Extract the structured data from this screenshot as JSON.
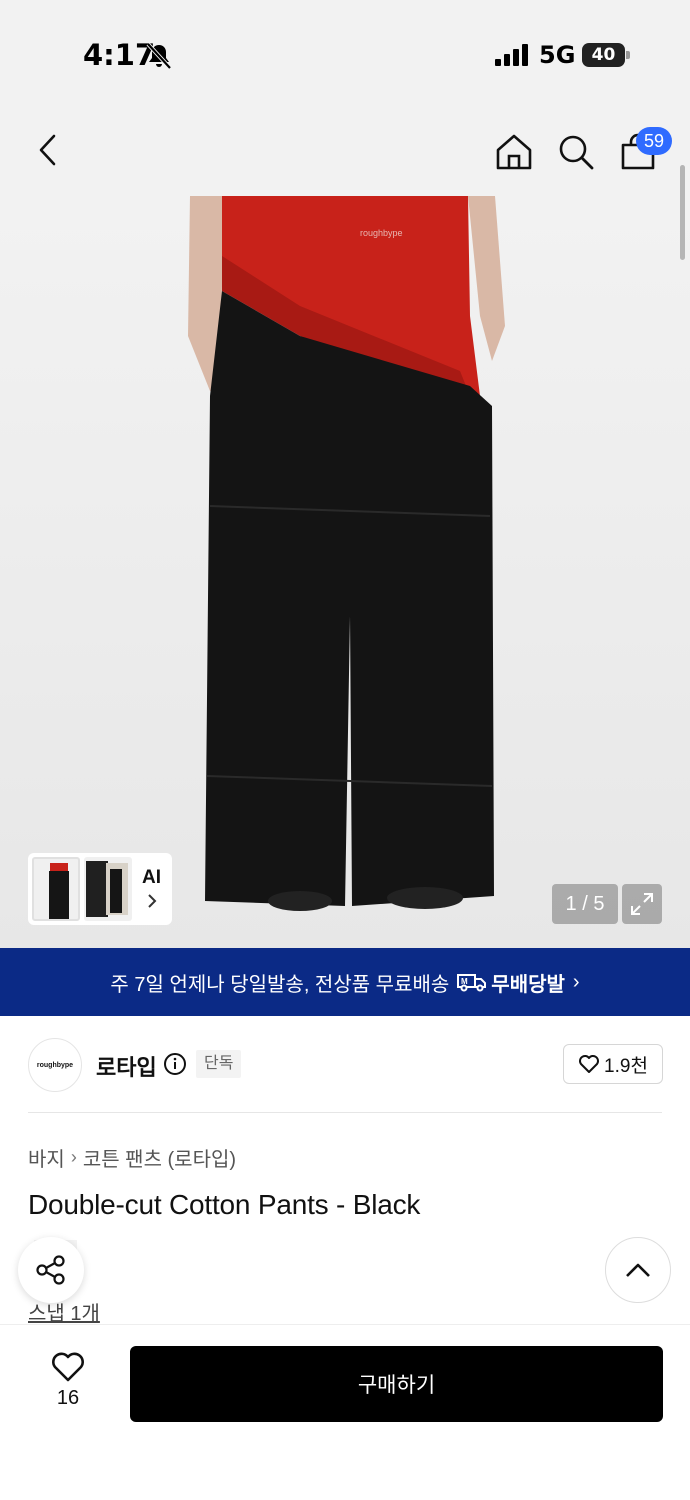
{
  "status_bar": {
    "time": "4:17",
    "network": "5G",
    "battery": "40"
  },
  "nav": {
    "cart_count": "59",
    "icons": [
      "back-icon",
      "home-icon",
      "search-icon",
      "cart-icon"
    ]
  },
  "gallery": {
    "ai_label": "AI",
    "page_counter": "1 / 5",
    "logo_text": "roughbype"
  },
  "banner": {
    "text": "주 7일 언제나 당일발송, 전상품 무료배송",
    "brand": "무배당발",
    "chevron": "›"
  },
  "brand": {
    "name": "로타입",
    "tag": "단독",
    "logo_text": "roughbype",
    "favorite_count": "1.9천"
  },
  "product": {
    "breadcrumb": [
      "바지",
      "코튼 팬츠 (로타입)"
    ],
    "breadcrumb_sep": "›",
    "title": "Double-cut Cotton Pants - Black",
    "tag": "단독",
    "snap_link": "스냅 1개"
  },
  "bottom_bar": {
    "like_count": "16",
    "buy_label": "구매하기"
  },
  "colors": {
    "banner_bg": "#0b2a86",
    "badge_blue": "#2f6bff",
    "buy_button": "#000000"
  }
}
